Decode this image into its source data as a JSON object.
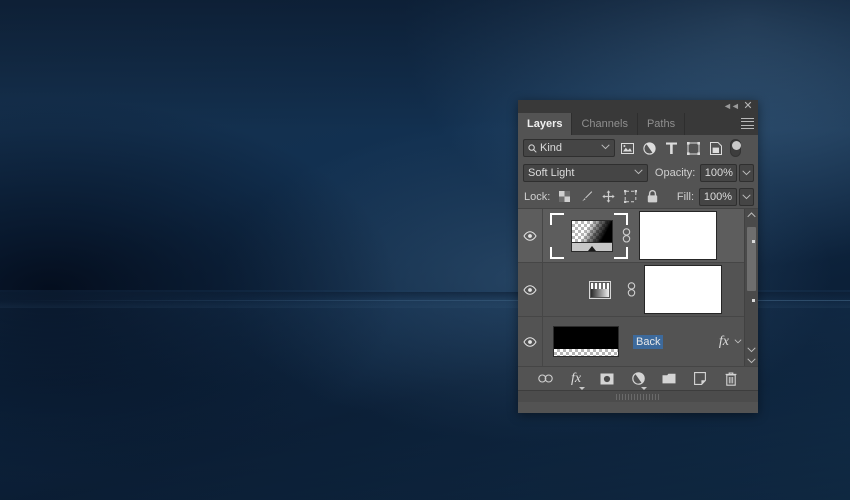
{
  "desktop": {
    "background_top_color": "#17304b",
    "background_mid_color": "#0c2038",
    "background_glow_color": "#4a7092"
  },
  "panel": {
    "titlebar": {
      "collapse_icon": "double-left-chevron-icon",
      "collapse_glyph": "◄◄",
      "close_icon": "close-icon",
      "close_glyph": "✕"
    },
    "tabs": [
      {
        "label": "Layers",
        "active": true
      },
      {
        "label": "Channels",
        "active": false
      },
      {
        "label": "Paths",
        "active": false
      }
    ],
    "menu_icon": "panel-menu-hamburger-icon",
    "filter_row": {
      "kind_label": "Kind",
      "search_icon": "magnifier-icon",
      "dropdown_icon": "chevron-down-icon",
      "filter_icons": [
        {
          "name": "pixel-layer-filter-icon",
          "title": "Pixel layers"
        },
        {
          "name": "adjustment-layer-filter-icon",
          "title": "Adjustment layers"
        },
        {
          "name": "type-layer-filter-icon",
          "title": "Type layers"
        },
        {
          "name": "shape-layer-filter-icon",
          "title": "Shape layers"
        },
        {
          "name": "smart-object-filter-icon",
          "title": "Smart objects"
        }
      ],
      "filter_toggle": {
        "name": "filter-enable-toggle",
        "state": "off"
      }
    },
    "blend_row": {
      "blend_mode": "Soft Light",
      "opacity_label": "Opacity:",
      "opacity_value": "100%"
    },
    "lock_row": {
      "lock_label": "Lock:",
      "lock_icons": [
        {
          "name": "lock-transparent-pixels-icon"
        },
        {
          "name": "lock-image-pixels-brush-icon"
        },
        {
          "name": "lock-position-move-icon"
        },
        {
          "name": "lock-artboard-nesting-icon"
        },
        {
          "name": "lock-all-padlock-icon"
        }
      ],
      "fill_label": "Fill:",
      "fill_value": "100%"
    },
    "layers": [
      {
        "name": "",
        "visible": true,
        "selected": true,
        "thumbnail": "gradient-map-thumbnail",
        "linked": true,
        "mask": "white-layer-mask",
        "has_fx": false
      },
      {
        "name": "",
        "visible": true,
        "selected": false,
        "thumbnail": "levels-adjustment-thumbnail",
        "linked": true,
        "mask": "white-layer-mask",
        "has_fx": false
      },
      {
        "name": "Back",
        "visible": true,
        "selected": false,
        "thumbnail": "black-fill-thumbnail",
        "linked": false,
        "mask": "",
        "has_fx": true,
        "fx_glyph": "fx"
      }
    ],
    "scrollbar": {
      "up_icon": "scroll-up-chevron-icon",
      "down_icon": "scroll-down-chevron-icon"
    },
    "bottom_toolbar": [
      {
        "name": "link-layers-button",
        "icon": "chain-link-icon"
      },
      {
        "name": "layer-style-button",
        "icon": "fx-icon",
        "glyph": "fx",
        "has_menu": true
      },
      {
        "name": "add-layer-mask-button",
        "icon": "mask-circle-icon"
      },
      {
        "name": "new-adjustment-layer-button",
        "icon": "half-filled-circle-icon",
        "has_menu": true
      },
      {
        "name": "new-group-button",
        "icon": "folder-icon"
      },
      {
        "name": "new-layer-button",
        "icon": "new-layer-page-icon"
      },
      {
        "name": "delete-layer-button",
        "icon": "trash-can-icon"
      }
    ],
    "resize_grip": "panel-resize-grip"
  }
}
